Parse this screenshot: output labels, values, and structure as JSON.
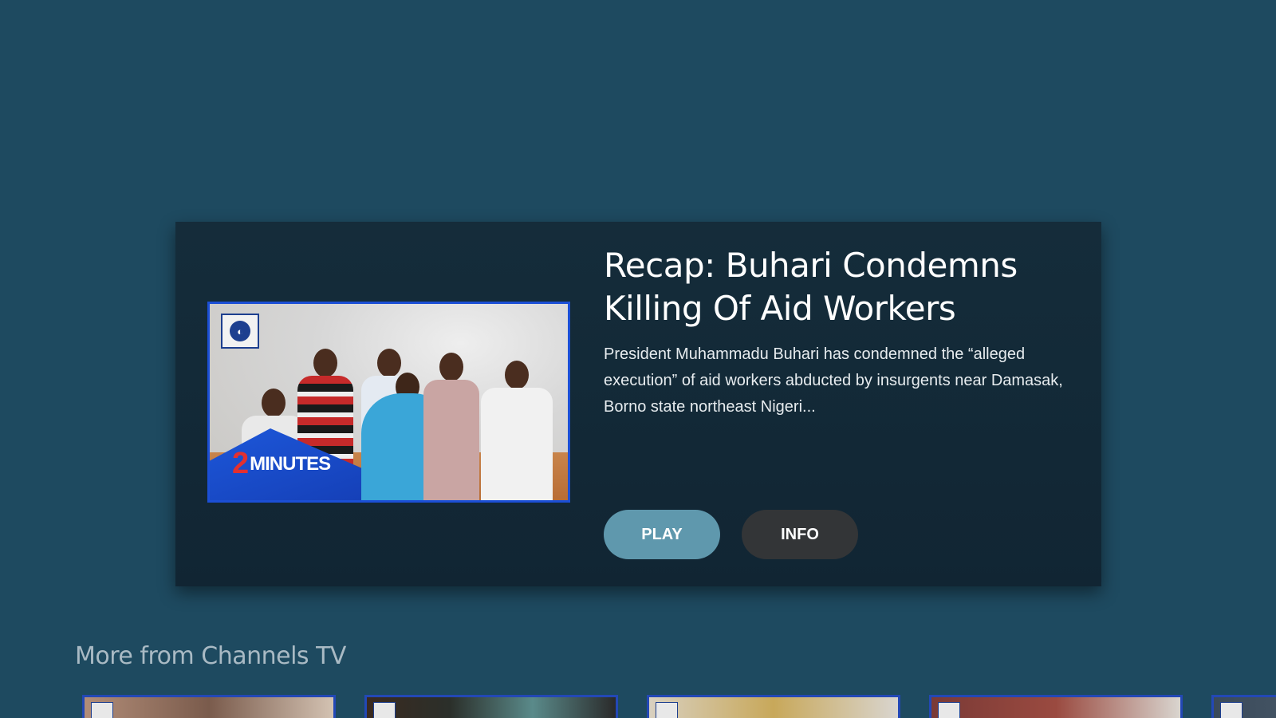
{
  "featured": {
    "title": "Recap: Buhari Condemns Killing Of Aid Workers",
    "description": "President Muhammadu Buhari has condemned the “alleged execution” of aid workers abducted by insurgents near Damasak, Borno state northeast Nigeri...",
    "thumbnail": {
      "logo_icon": "channels-tv-logo-icon",
      "banner_number": "2",
      "banner_word": "MINUTES"
    },
    "buttons": {
      "play_label": "PLAY",
      "info_label": "INFO"
    }
  },
  "row": {
    "title": "More from Channels TV",
    "cards": [
      {
        "name": "card-1",
        "color": "#8a6a5a"
      },
      {
        "name": "card-2",
        "color": "#2b2f2a"
      },
      {
        "name": "card-3",
        "color": "#b8a57a"
      },
      {
        "name": "card-4",
        "color": "#6b3a36"
      },
      {
        "name": "card-5",
        "color": "#3a4a5a"
      }
    ]
  },
  "colors": {
    "background": "#1e4a60",
    "card": "#112533",
    "play_button": "#5f98ad",
    "info_button": "#333537",
    "thumbnail_border": "#1b4fd6"
  }
}
